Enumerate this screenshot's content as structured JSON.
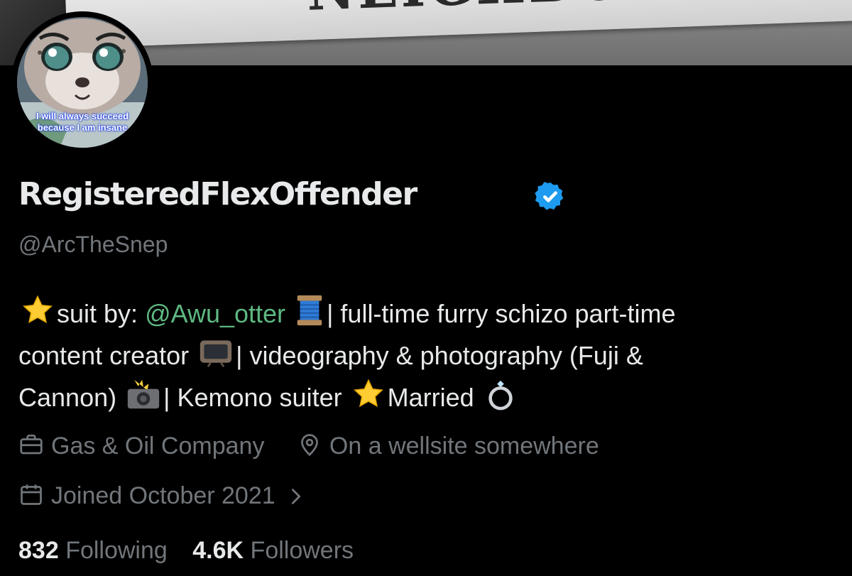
{
  "banner": {
    "sign_text": "NEIGHBORHOOD."
  },
  "avatar": {
    "caption_line1": "I will always succeed",
    "caption_line2": "because I am insane"
  },
  "profile": {
    "display_name": "RegisteredFlexOffender",
    "verified": true,
    "verified_color": "#1d9bf0",
    "handle": "@ArcTheSnep"
  },
  "bio": {
    "line1_a": "suit by: ",
    "mention": "@Awu_otter",
    "line1_b": "| full-time furry schizo part-time",
    "line2_a": "content creator",
    "line2_b": "| videography & photography (Fuji &",
    "line3_a": "Cannon)",
    "line3_b": "| Kemono suiter",
    "line3_c": "Married",
    "mention_color": "#5eb882"
  },
  "meta": {
    "work": "Gas & Oil Company",
    "location": "On a wellsite somewhere",
    "joined": "Joined October 2021",
    "work_icon": "briefcase-icon",
    "location_icon": "location-pin-icon",
    "joined_icon": "calendar-icon"
  },
  "stats": {
    "following_count": "832",
    "following_label": "Following",
    "followers_count": "4.6K",
    "followers_label": "Followers"
  }
}
